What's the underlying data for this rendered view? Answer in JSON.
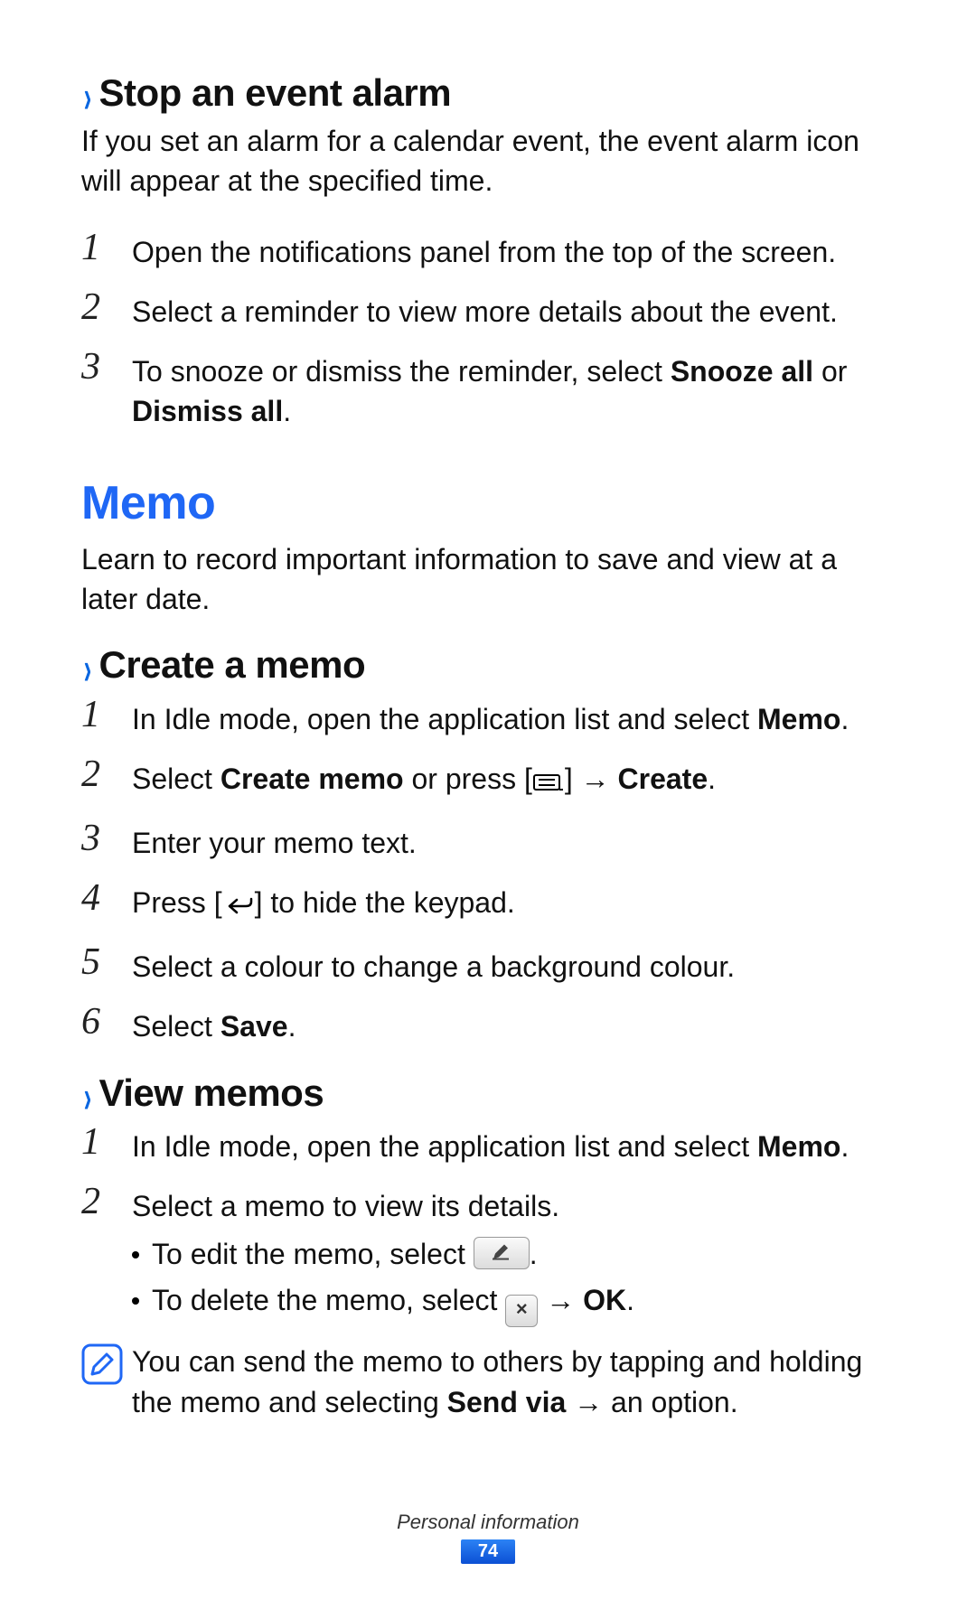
{
  "section1": {
    "heading": "Stop an event alarm",
    "intro": "If you set an alarm for a calendar event, the event alarm icon will appear at the specified time.",
    "steps": {
      "s1": "Open the notifications panel from the top of the screen.",
      "s2": "Select a reminder to view more details about the event.",
      "s3_a": "To snooze or dismiss the reminder, select ",
      "s3_b1": "Snooze all",
      "s3_or": " or ",
      "s3_b2": "Dismiss all",
      "s3_end": "."
    }
  },
  "memo": {
    "title": "Memo",
    "intro": "Learn to record important information to save and view at a later date."
  },
  "create": {
    "heading": "Create a memo",
    "s1_a": "In Idle mode, open the application list and select ",
    "s1_b": "Memo",
    "s1_end": ".",
    "s2_a": "Select ",
    "s2_b": "Create memo",
    "s2_mid": " or press [",
    "s2_arrow": "] → ",
    "s2_c": "Create",
    "s2_end": ".",
    "s3": "Enter your memo text.",
    "s4_a": "Press [",
    "s4_b": "] to hide the keypad.",
    "s5": "Select a colour to change a background colour.",
    "s6_a": "Select ",
    "s6_b": "Save",
    "s6_end": "."
  },
  "view": {
    "heading": "View memos",
    "s1_a": "In Idle mode, open the application list and select ",
    "s1_b": "Memo",
    "s1_end": ".",
    "s2": "Select a memo to view its details.",
    "b1_a": "To edit the memo, select ",
    "b1_end": ".",
    "b2_a": "To delete the memo, select ",
    "b2_arrow": " → ",
    "b2_b": "OK",
    "b2_end": ".",
    "note_a": "You can send the memo to others by tapping and holding the memo and selecting ",
    "note_b": "Send via",
    "note_c": " → an option."
  },
  "footer": {
    "section": "Personal information",
    "page": "74"
  },
  "nums": {
    "n1": "1",
    "n2": "2",
    "n3": "3",
    "n4": "4",
    "n5": "5",
    "n6": "6"
  }
}
